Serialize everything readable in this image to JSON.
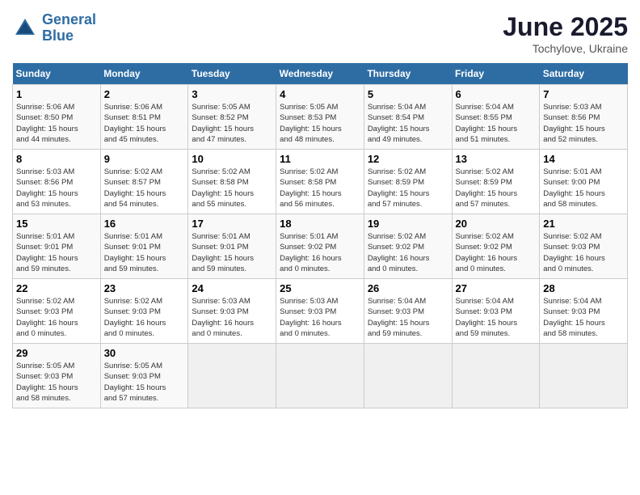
{
  "header": {
    "logo_line1": "General",
    "logo_line2": "Blue",
    "title": "June 2025",
    "subtitle": "Tochylove, Ukraine"
  },
  "calendar": {
    "headers": [
      "Sunday",
      "Monday",
      "Tuesday",
      "Wednesday",
      "Thursday",
      "Friday",
      "Saturday"
    ],
    "weeks": [
      [
        {
          "day": "",
          "info": ""
        },
        {
          "day": "2",
          "info": "Sunrise: 5:06 AM\nSunset: 8:51 PM\nDaylight: 15 hours\nand 45 minutes."
        },
        {
          "day": "3",
          "info": "Sunrise: 5:05 AM\nSunset: 8:52 PM\nDaylight: 15 hours\nand 47 minutes."
        },
        {
          "day": "4",
          "info": "Sunrise: 5:05 AM\nSunset: 8:53 PM\nDaylight: 15 hours\nand 48 minutes."
        },
        {
          "day": "5",
          "info": "Sunrise: 5:04 AM\nSunset: 8:54 PM\nDaylight: 15 hours\nand 49 minutes."
        },
        {
          "day": "6",
          "info": "Sunrise: 5:04 AM\nSunset: 8:55 PM\nDaylight: 15 hours\nand 51 minutes."
        },
        {
          "day": "7",
          "info": "Sunrise: 5:03 AM\nSunset: 8:56 PM\nDaylight: 15 hours\nand 52 minutes."
        }
      ],
      [
        {
          "day": "1",
          "info": "Sunrise: 5:06 AM\nSunset: 8:50 PM\nDaylight: 15 hours\nand 44 minutes."
        },
        {
          "day": "9",
          "info": "Sunrise: 5:02 AM\nSunset: 8:57 PM\nDaylight: 15 hours\nand 54 minutes."
        },
        {
          "day": "10",
          "info": "Sunrise: 5:02 AM\nSunset: 8:58 PM\nDaylight: 15 hours\nand 55 minutes."
        },
        {
          "day": "11",
          "info": "Sunrise: 5:02 AM\nSunset: 8:58 PM\nDaylight: 15 hours\nand 56 minutes."
        },
        {
          "day": "12",
          "info": "Sunrise: 5:02 AM\nSunset: 8:59 PM\nDaylight: 15 hours\nand 57 minutes."
        },
        {
          "day": "13",
          "info": "Sunrise: 5:02 AM\nSunset: 8:59 PM\nDaylight: 15 hours\nand 57 minutes."
        },
        {
          "day": "14",
          "info": "Sunrise: 5:01 AM\nSunset: 9:00 PM\nDaylight: 15 hours\nand 58 minutes."
        }
      ],
      [
        {
          "day": "8",
          "info": "Sunrise: 5:03 AM\nSunset: 8:56 PM\nDaylight: 15 hours\nand 53 minutes."
        },
        {
          "day": "16",
          "info": "Sunrise: 5:01 AM\nSunset: 9:01 PM\nDaylight: 15 hours\nand 59 minutes."
        },
        {
          "day": "17",
          "info": "Sunrise: 5:01 AM\nSunset: 9:01 PM\nDaylight: 15 hours\nand 59 minutes."
        },
        {
          "day": "18",
          "info": "Sunrise: 5:01 AM\nSunset: 9:02 PM\nDaylight: 16 hours\nand 0 minutes."
        },
        {
          "day": "19",
          "info": "Sunrise: 5:02 AM\nSunset: 9:02 PM\nDaylight: 16 hours\nand 0 minutes."
        },
        {
          "day": "20",
          "info": "Sunrise: 5:02 AM\nSunset: 9:02 PM\nDaylight: 16 hours\nand 0 minutes."
        },
        {
          "day": "21",
          "info": "Sunrise: 5:02 AM\nSunset: 9:03 PM\nDaylight: 16 hours\nand 0 minutes."
        }
      ],
      [
        {
          "day": "15",
          "info": "Sunrise: 5:01 AM\nSunset: 9:01 PM\nDaylight: 15 hours\nand 59 minutes."
        },
        {
          "day": "23",
          "info": "Sunrise: 5:02 AM\nSunset: 9:03 PM\nDaylight: 16 hours\nand 0 minutes."
        },
        {
          "day": "24",
          "info": "Sunrise: 5:03 AM\nSunset: 9:03 PM\nDaylight: 16 hours\nand 0 minutes."
        },
        {
          "day": "25",
          "info": "Sunrise: 5:03 AM\nSunset: 9:03 PM\nDaylight: 16 hours\nand 0 minutes."
        },
        {
          "day": "26",
          "info": "Sunrise: 5:04 AM\nSunset: 9:03 PM\nDaylight: 15 hours\nand 59 minutes."
        },
        {
          "day": "27",
          "info": "Sunrise: 5:04 AM\nSunset: 9:03 PM\nDaylight: 15 hours\nand 59 minutes."
        },
        {
          "day": "28",
          "info": "Sunrise: 5:04 AM\nSunset: 9:03 PM\nDaylight: 15 hours\nand 58 minutes."
        }
      ],
      [
        {
          "day": "22",
          "info": "Sunrise: 5:02 AM\nSunset: 9:03 PM\nDaylight: 16 hours\nand 0 minutes."
        },
        {
          "day": "30",
          "info": "Sunrise: 5:05 AM\nSunset: 9:03 PM\nDaylight: 15 hours\nand 57 minutes."
        },
        {
          "day": "",
          "info": ""
        },
        {
          "day": "",
          "info": ""
        },
        {
          "day": "",
          "info": ""
        },
        {
          "day": "",
          "info": ""
        },
        {
          "day": ""
        }
      ],
      [
        {
          "day": "29",
          "info": "Sunrise: 5:05 AM\nSunset: 9:03 PM\nDaylight: 15 hours\nand 58 minutes."
        },
        {
          "day": "",
          "info": ""
        },
        {
          "day": "",
          "info": ""
        },
        {
          "day": "",
          "info": ""
        },
        {
          "day": "",
          "info": ""
        },
        {
          "day": "",
          "info": ""
        },
        {
          "day": "",
          "info": ""
        }
      ]
    ]
  }
}
